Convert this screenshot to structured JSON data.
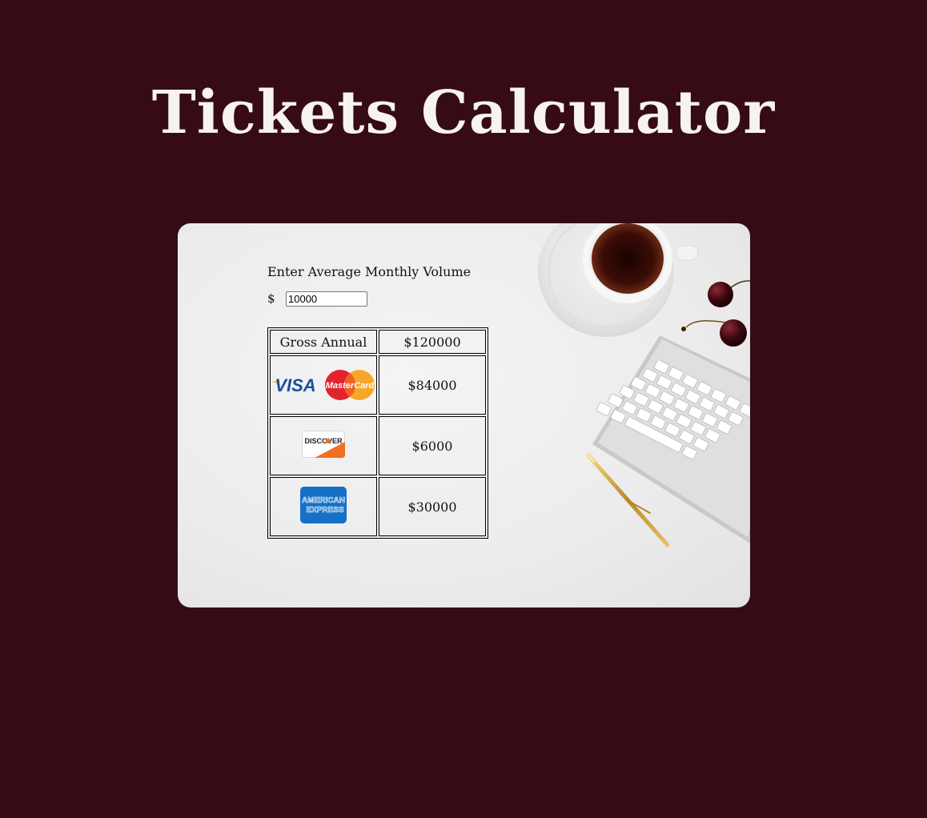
{
  "header": {
    "title": "Tickets Calculator"
  },
  "calculator": {
    "prompt": "Enter Average Monthly Volume",
    "currency_symbol": "$",
    "monthly_volume_value": "10000"
  },
  "results": {
    "gross_label": "Gross Annual",
    "gross_value": "$120000",
    "rows": [
      {
        "brands": [
          "visa-logo",
          "mastercard-logo"
        ],
        "value": "$84000"
      },
      {
        "brands": [
          "discover-logo"
        ],
        "value": "$6000"
      },
      {
        "brands": [
          "american-express-logo"
        ],
        "value": "$30000"
      }
    ]
  },
  "logos": {
    "visa": "VISA",
    "mastercard": "MasterCard",
    "discover": "DISCOVER",
    "amex_line1": "AMERICAN",
    "amex_line2": "EXPRESS"
  },
  "colors": {
    "page_background": "#360b15",
    "title_text": "#f6f3f1",
    "card_background": "#ececed",
    "visa_blue": "#1a1f71",
    "mastercard_red": "#eb001b",
    "mastercard_orange": "#f79e1b",
    "discover_orange": "#f26e21",
    "amex_blue": "#1570c6"
  }
}
